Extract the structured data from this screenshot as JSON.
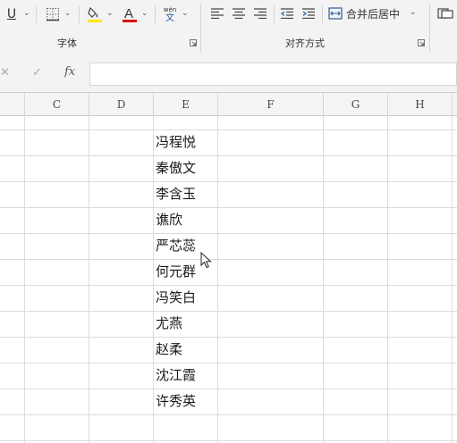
{
  "ribbon": {
    "font_group_label": "字体",
    "align_group_label": "对齐方式",
    "merge_button_label": "合并后居中",
    "underline_glyph": "U",
    "font_color_glyph": "A",
    "phonetic_top": "wén",
    "phonetic_bottom": "文",
    "colors": {
      "highlight": "#ffe600",
      "font_color": "#e01010",
      "accent": "#2a5d9f"
    }
  },
  "formula_bar": {
    "cancel_glyph": "✕",
    "confirm_glyph": "✓",
    "fx_glyph": "fx",
    "value": ""
  },
  "sheet": {
    "columns": [
      "C",
      "D",
      "E",
      "F",
      "G",
      "H"
    ],
    "column_e_values": [
      "冯程悦",
      "秦傲文",
      "李含玉",
      "谯欣",
      "严芯蕊",
      "何元群",
      "冯笑白",
      "尤燕",
      "赵柔",
      "沈江霞",
      "许秀英"
    ]
  }
}
